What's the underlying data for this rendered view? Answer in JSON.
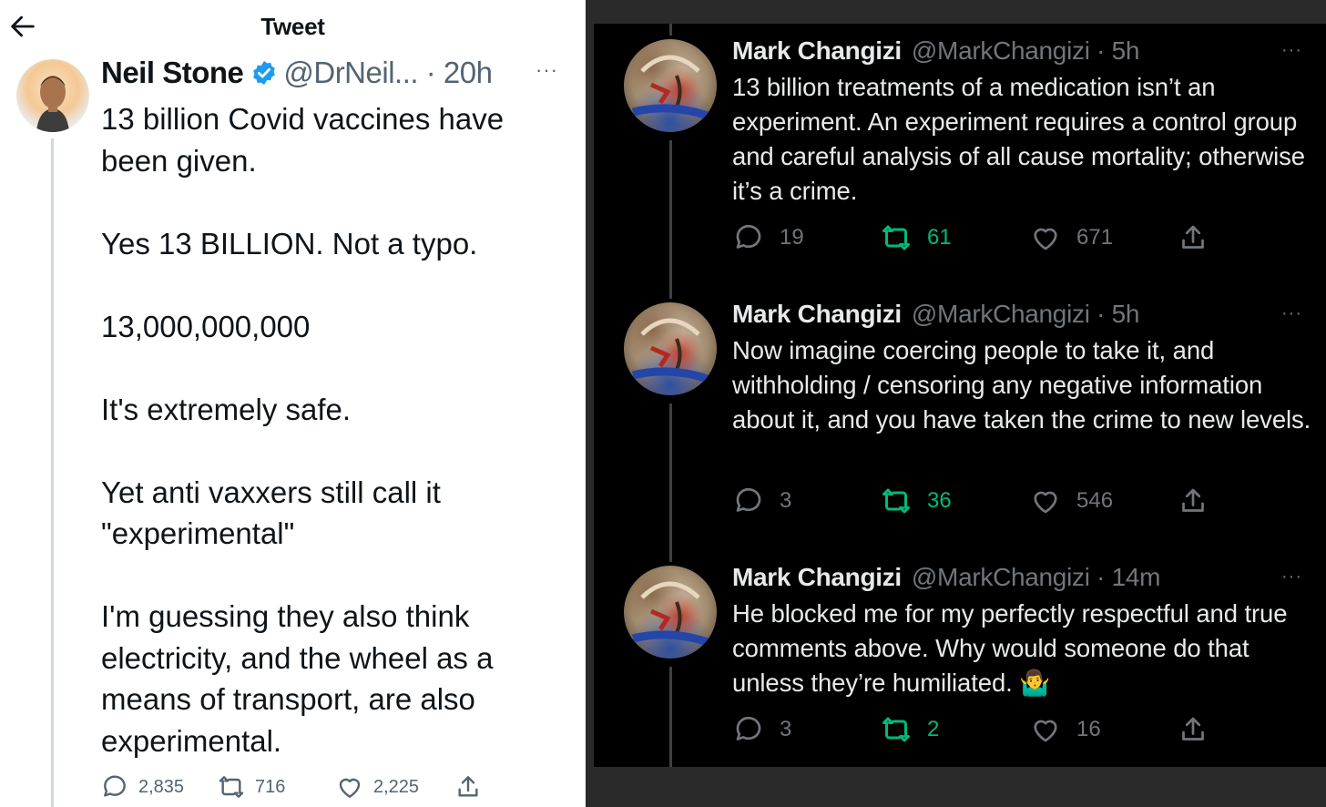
{
  "left": {
    "header_title": "Tweet",
    "author": {
      "name": "Neil Stone",
      "handle_time": "@DrNeil... · 20h"
    },
    "body": [
      "13 billion Covid vaccines have been given.",
      "Yes 13 BILLION. Not a typo.",
      "13,000,000,000",
      "It's extremely safe.",
      "Yet anti vaxxers still call it \"experimental\"",
      "I'm guessing they also think electricity, and the wheel as a means of transport,  are also experimental."
    ],
    "stats": {
      "replies": "2,835",
      "retweets": "716",
      "likes": "2,225"
    },
    "more": "···",
    "colors": {
      "verified": "#1d9bf0",
      "text": "#0f1419",
      "muted": "#536471"
    }
  },
  "right": {
    "replies": [
      {
        "name": "Mark Changizi",
        "handle_time": "@MarkChangizi · 5h",
        "text": "13 billion treatments of a medication isn’t an experiment. An experiment requires a control group and careful analysis of all cause mortality; otherwise it’s a crime.",
        "stats": {
          "replies": "19",
          "retweets": "61",
          "likes": "671"
        }
      },
      {
        "name": "Mark Changizi",
        "handle_time": "@MarkChangizi · 5h",
        "text": "Now imagine coercing people to take it, and withholding / censoring any negative information about it, and you have taken the crime to new levels.",
        "stats": {
          "replies": "3",
          "retweets": "36",
          "likes": "546"
        }
      },
      {
        "name": "Mark Changizi",
        "handle_time": "@MarkChangizi · 14m",
        "text": "He blocked me for my perfectly respectful and true comments above. Why would someone do that unless they’re humiliated. 🤷‍♂️",
        "stats": {
          "replies": "3",
          "retweets": "2",
          "likes": "16"
        }
      }
    ],
    "more": "···",
    "colors": {
      "retweet": "#00ba7c",
      "text": "#e7e9ea",
      "muted": "#71767b",
      "background": "#000000"
    }
  }
}
